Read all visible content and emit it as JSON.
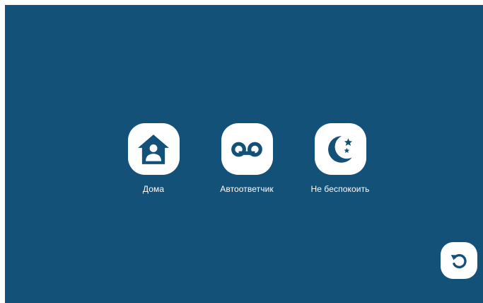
{
  "colors": {
    "background": "#145179",
    "tile": "#ffffff",
    "icon": "#145179",
    "text": "#ffffff"
  },
  "modes": [
    {
      "label": "Дома",
      "icon": "home-user-icon"
    },
    {
      "label": "Автоответчик",
      "icon": "voicemail-icon"
    },
    {
      "label": "Не беспокоить",
      "icon": "moon-stars-icon"
    }
  ],
  "back_button": {
    "icon": "undo-arrow-icon"
  }
}
